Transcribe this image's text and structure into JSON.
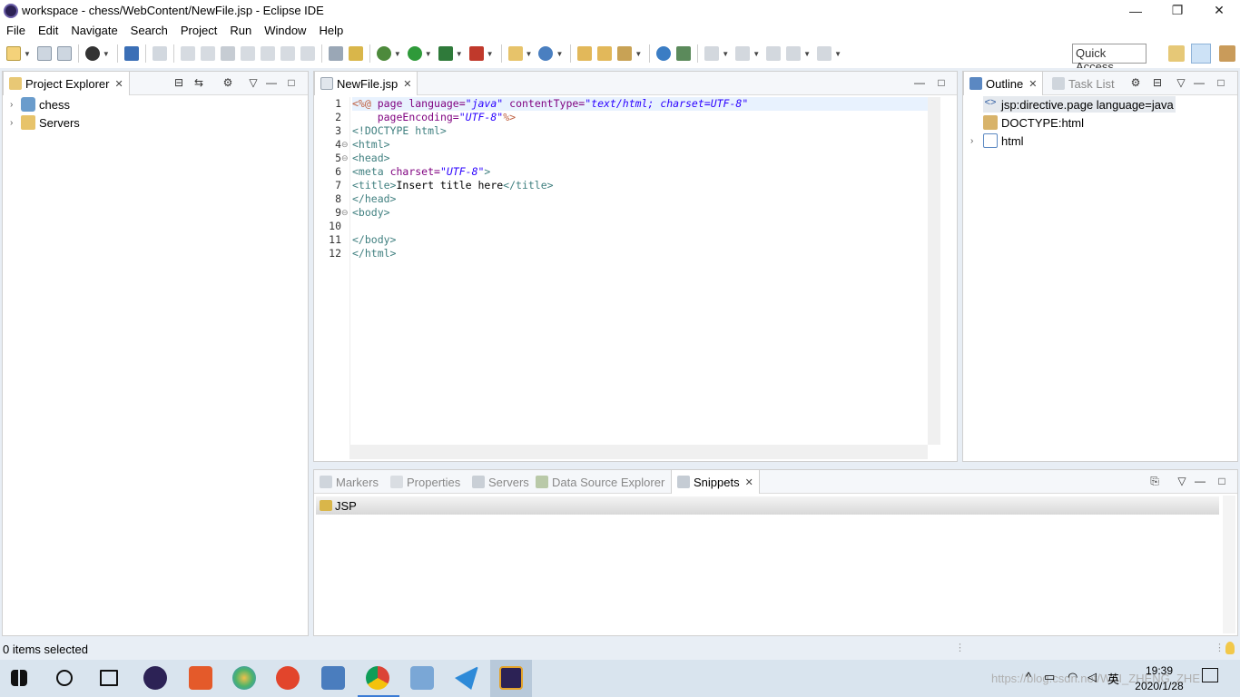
{
  "window": {
    "title": "workspace - chess/WebContent/NewFile.jsp - Eclipse IDE",
    "controls": [
      "—",
      "❐",
      "✕"
    ]
  },
  "menu": [
    "File",
    "Edit",
    "Navigate",
    "Search",
    "Project",
    "Run",
    "Window",
    "Help"
  ],
  "toolbar": {
    "quick_access": "Quick Access"
  },
  "project_explorer": {
    "tab_label": "Project Explorer",
    "items": [
      {
        "label": "chess",
        "icon": "web-project-icon"
      },
      {
        "label": "Servers",
        "icon": "folder-icon"
      }
    ]
  },
  "editor": {
    "tab_label": "NewFile.jsp",
    "lines": [
      {
        "n": "1",
        "fold": "",
        "text": "<%@ page language=\"java\" contentType=\"text/html; charset=UTF-8\""
      },
      {
        "n": "2",
        "fold": "",
        "text": "    pageEncoding=\"UTF-8\"%>"
      },
      {
        "n": "3",
        "fold": "",
        "text": "<!DOCTYPE html>"
      },
      {
        "n": "4",
        "fold": "⊖",
        "text": "<html>"
      },
      {
        "n": "5",
        "fold": "⊖",
        "text": "<head>"
      },
      {
        "n": "6",
        "fold": "",
        "text": "<meta charset=\"UTF-8\">"
      },
      {
        "n": "7",
        "fold": "",
        "text": "<title>Insert title here</title>"
      },
      {
        "n": "8",
        "fold": "",
        "text": "</head>"
      },
      {
        "n": "9",
        "fold": "⊖",
        "text": "<body>"
      },
      {
        "n": "10",
        "fold": "",
        "text": ""
      },
      {
        "n": "11",
        "fold": "",
        "text": "</body>"
      },
      {
        "n": "12",
        "fold": "",
        "text": "</html>"
      }
    ]
  },
  "outline": {
    "tab_label": "Outline",
    "tab2_label": "Task List",
    "items": [
      {
        "label": "jsp:directive.page language=java",
        "icon": "jsp-directive-icon"
      },
      {
        "label": "DOCTYPE:html",
        "icon": "doctype-icon"
      },
      {
        "label": "html",
        "icon": "html-element-icon"
      }
    ]
  },
  "bottom": {
    "tabs": [
      "Markers",
      "Properties",
      "Servers",
      "Data Source Explorer",
      "Snippets"
    ],
    "active_tab": "Snippets",
    "drawer_label": "JSP"
  },
  "status": {
    "text": "0 items selected"
  },
  "taskbar": {
    "time": "19:39",
    "date": "2020/1/28",
    "ime": "英",
    "watermark": "https://blog.csdn.net/WAI_ZHENG_ZHE"
  },
  "colors": {
    "accent": "#b8c9da",
    "tag": "#3f7f7f",
    "attr": "#7f007f",
    "value": "#2a00ff"
  }
}
